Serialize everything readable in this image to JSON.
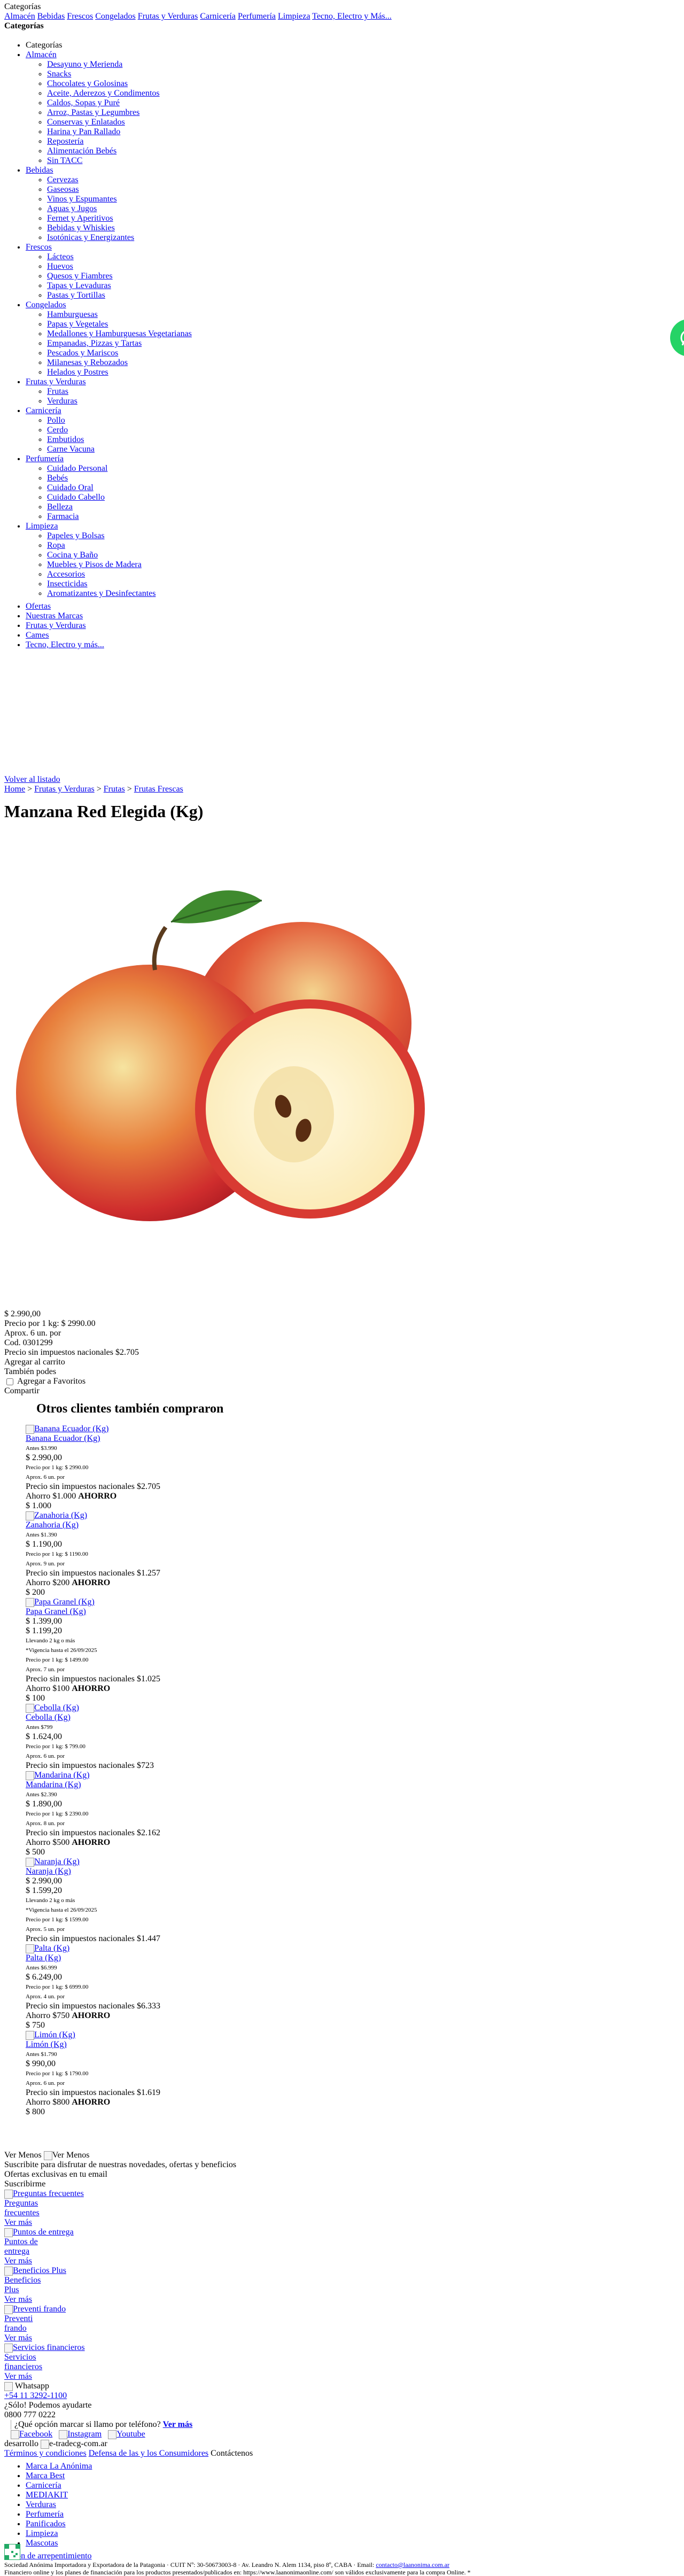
{
  "header": {
    "categorias_top": "Categorías",
    "top_nav": [
      "Almacén",
      "Bebidas",
      "Frescos",
      "Congelados",
      "Frutas y Verduras",
      "Carnicería",
      "Perfumería",
      "Limpieza",
      "Tecno, Electro y Más..."
    ],
    "categorias_bold": "Categorías"
  },
  "menu": {
    "root_label": "Categorías",
    "groups": [
      {
        "label": "Almacén",
        "items": [
          "Desayuno y Merienda",
          "Snacks",
          "Chocolates y Golosinas",
          "Aceite, Aderezos y Condimentos",
          "Caldos, Sopas y Puré",
          "Arroz, Pastas y Legumbres",
          "Conservas y Enlatados",
          "Harina y Pan Rallado",
          "Repostería",
          "Alimentación Bebés",
          "Sin TACC"
        ]
      },
      {
        "label": "Bebidas",
        "items": [
          "Cervezas",
          "Gaseosas",
          "Vinos y Espumantes",
          "Aguas y Jugos",
          "Fernet y Aperitivos",
          "Bebidas y Whiskies",
          "Isotónicas y Energizantes"
        ]
      },
      {
        "label": "Frescos",
        "items": [
          "Lácteos",
          "Huevos",
          "Quesos y Fiambres",
          "Tapas y Levaduras",
          "Pastas y Tortillas"
        ]
      },
      {
        "label": "Congelados",
        "items": [
          "Hamburguesas",
          "Papas y Vegetales",
          "Medallones y Hamburguesas Vegetarianas",
          "Empanadas, Pizzas y Tartas",
          "Pescados y Mariscos",
          "Milanesas y Rebozados",
          "Helados y Postres"
        ]
      },
      {
        "label": "Frutas y Verduras",
        "items": [
          "Frutas",
          "Verduras"
        ]
      },
      {
        "label": "Carnicería",
        "items": [
          "Pollo",
          "Cerdo",
          "Embutidos",
          "Carne Vacuna"
        ]
      },
      {
        "label": "Perfumería",
        "items": [
          "Cuidado Personal",
          "Bebés",
          "Cuidado Oral",
          "Cuidado Cabello",
          "Belleza",
          "Farmacia"
        ]
      },
      {
        "label": "Limpieza",
        "items": [
          "Papeles y Bolsas",
          "Ropa",
          "Cocina y Baño",
          "Muebles y Pisos de Madera",
          "Accesorios",
          "Insecticidas",
          "Aromatizantes y Desinfectantes"
        ]
      }
    ],
    "extras": [
      "Ofertas",
      "Nuestras Marcas",
      "Frutas y Verduras",
      "Cames",
      "Tecno, Electro y más..."
    ]
  },
  "product": {
    "back_link": "Volver al listado",
    "breadcrumb": [
      "Home",
      "Frutas y Verduras",
      "Frutas",
      "Frutas Frescas"
    ],
    "breadcrumb_sep": ">",
    "title": "Manzana Red Elegida (Kg)",
    "price": "$ 2.990,00",
    "unit_price": "Precio por 1 kg: $ 2990.00",
    "approx": "Aprox. 6 un. por",
    "code": "Cod. 0301299",
    "no_tax": "Precio sin impuestos nacionales $2.705",
    "add_cart": "Agregar al carrito",
    "also_can": "También podes",
    "add_fav": "Agregar a Favoritos",
    "share": "Compartir"
  },
  "related": {
    "heading": "Otros clientes también compraron",
    "items": [
      {
        "img": "Banana Ecuador (Kg)",
        "name": "Banana Ecuador (Kg)",
        "before": "Antes $3.990",
        "price": "$ 2.990,00",
        "unit": "Precio por 1 kg: $ 2990.00",
        "approx": "Aprox. 6 un. por",
        "notax": "Precio sin impuestos nacionales $2.705",
        "save": "Ahorro $1.000",
        "save_bold": "AHORRO",
        "save_amt": "$ 1.000"
      },
      {
        "img": "Zanahoria (Kg)",
        "name": "Zanahoria (Kg)",
        "before": "Antes $1.390",
        "price": "$ 1.190,00",
        "unit": "Precio por 1 kg: $ 1190.00",
        "approx": "Aprox. 9 un. por",
        "notax": "Precio sin impuestos nacionales $1.257",
        "save": "Ahorro $200",
        "save_bold": "AHORRO",
        "save_amt": "$ 200"
      },
      {
        "img": "Papa Granel (Kg)",
        "name": "Papa Granel (Kg)",
        "before": "",
        "price": "$ 1.399,00",
        "price2": "$ 1.199,20",
        "promo": "Llevando 2 kg o más",
        "promo2": "*Vigencia hasta el 26/09/2025",
        "unit": "Precio por 1 kg: $ 1499.00",
        "approx": "Aprox. 7 un. por",
        "notax": "Precio sin impuestos nacionales $1.025",
        "save": "Ahorro $100",
        "save_bold": "AHORRO",
        "save_amt": "$ 100"
      },
      {
        "img": "Cebolla (Kg)",
        "name": "Cebolla (Kg)",
        "before": "Antes $799",
        "price": "$ 1.624,00",
        "unit": "Precio por 1 kg: $ 799.00",
        "approx": "Aprox. 6 un. por",
        "notax": "Precio sin impuestos nacionales $723",
        "save": "",
        "save_bold": "",
        "save_amt": ""
      },
      {
        "img": "Mandarina (Kg)",
        "name": "Mandarina (Kg)",
        "before": "Antes $2.390",
        "price": "$ 1.890,00",
        "unit": "Precio por 1 kg: $ 2390.00",
        "approx": "Aprox. 8 un. por",
        "notax": "Precio sin impuestos nacionales $2.162",
        "save": "Ahorro $500",
        "save_bold": "AHORRO",
        "save_amt": "$ 500"
      },
      {
        "img": "Naranja (Kg)",
        "name": "Naranja (Kg)",
        "before": "",
        "price": "$ 2.990,00",
        "price2": "$ 1.599,20",
        "promo": "Llevando 2 kg o más",
        "promo2": "*Vigencia hasta el 26/09/2025",
        "unit": "Precio por 1 kg: $ 1599.00",
        "approx": "Aprox. 5 un. por",
        "notax": "Precio sin impuestos nacionales $1.447",
        "save": "",
        "save_bold": "",
        "save_amt": ""
      },
      {
        "img": "Palta (Kg)",
        "name": "Palta (Kg)",
        "before": "Antes $6.999",
        "price": "$ 6.249,00",
        "unit": "Precio por 1 kg: $ 6999.00",
        "approx": "Aprox. 4 un. por",
        "notax": "Precio sin impuestos nacionales $6.333",
        "save": "Ahorro $750",
        "save_bold": "AHORRO",
        "save_amt": "$ 750"
      },
      {
        "img": "Limón (Kg)",
        "name": "Limón (Kg)",
        "before": "Antes $1.790",
        "price": "$ 990,00",
        "unit": "Precio por 1 kg: $ 1790.00",
        "approx": "Aprox. 6 un. por",
        "notax": "Precio sin impuestos nacionales $1.619",
        "save": "Ahorro $800",
        "save_bold": "AHORRO",
        "save_amt": "$ 800"
      }
    ]
  },
  "footer": {
    "ver_mas": "Ver Menos",
    "ver_mas_img": "Ver Menos",
    "subscribe_1": "Suscribite para disfrutar de nuestras novedades, ofertas y beneficios",
    "subscribe_2": "Ofertas exclusivas en tu email",
    "subscribe_3": "Suscribirme",
    "features": [
      {
        "img": "Preguntas frecuentes",
        "title1": "Preguntas",
        "title2": "frecuentes",
        "link": "Ver más"
      },
      {
        "img": "Puntos de entrega",
        "title1": "Puntos de",
        "title2": "entrega",
        "link": "Ver más"
      },
      {
        "img": "Beneficios Plus",
        "title1": "Beneficios",
        "title2": "Plus",
        "link": "Ver más"
      },
      {
        "img": "Preventi frando",
        "title1": "Preventi",
        "title2": "frando",
        "link": "Ver más"
      },
      {
        "img": "Servicios financieros",
        "title1": "Servicios",
        "title2": "financieros",
        "link": "Ver más"
      }
    ],
    "whatsapp_label": "Whatsapp",
    "whatsapp_phone": "+54 11 3292-1100",
    "help": "¿Sólo! Podemos ayudarte",
    "phone": "0800 777 0222",
    "call_question": "¿Qué opción marcar si llamo por teléfono?",
    "call_link": "Ver más",
    "social": [
      "Facebook",
      "Instagram",
      "Youtube"
    ],
    "dev": "desarrollo",
    "dev_img": "e-tradecg-com.ar",
    "legal_links": [
      "Términos y condiciones",
      "Defensa de las y los Consumidores"
    ],
    "contact": "Contáctenos",
    "brands": [
      "Marca La Anónima",
      "Marca Best",
      "Carnicería",
      "MEDIAKIT",
      "Verduras",
      "Perfumería",
      "Panificados",
      "Limpieza",
      "Mascotas"
    ],
    "returns": "Botón de arrepentimiento",
    "company": "Sociedad Anónima Importadora y Exportadora de la Patagonia · CUIT Nº: 30-50673003-8 · Av. Leandro N. Alem 1134, piso 8º, CABA · Email:",
    "company_email": "contacto@laanonima.com.ar",
    "finance": "Financiero online y los planes de financiación para los productos presentados/publicados en: https://www.laanonimaonline.com/ son válidos exclusivamente para la compra Online. *"
  },
  "colors": {
    "whatsapp": "#25d366",
    "link": "#0000ee"
  }
}
